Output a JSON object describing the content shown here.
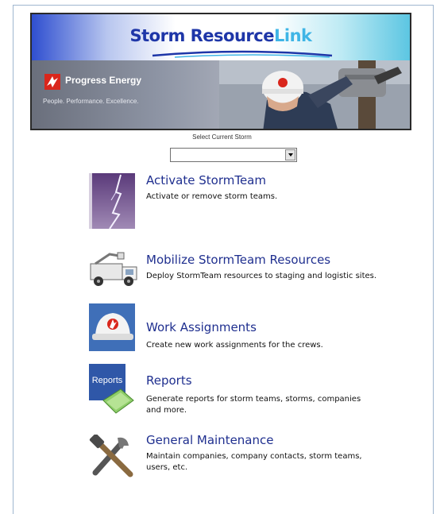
{
  "banner": {
    "app_name_part1": "Storm Resource",
    "app_name_part2": "Link",
    "company_name": "Progress Energy",
    "company_tagline": "People. Performance. Excellence.",
    "accent_colors": {
      "brand_blue": "#1e36a8",
      "brand_light": "#3fb5e6",
      "logo_red": "#d9261c"
    }
  },
  "storm_select": {
    "label": "Select Current Storm",
    "selected_value": ""
  },
  "menu": [
    {
      "title": "Activate StormTeam",
      "description": "Activate or remove storm teams.",
      "icon": "lightning-icon"
    },
    {
      "title": "Mobilize StormTeam Resources",
      "description": "Deploy StormTeam resources to staging and logistic sites.",
      "icon": "bucket-truck-icon"
    },
    {
      "title": "Work Assignments",
      "description": "Create new work assignments for the crews.",
      "icon": "hard-hat-icon"
    },
    {
      "title": "Reports",
      "description": "Generate reports for storm teams, storms, companies and more.",
      "icon": "reports-icon",
      "icon_label": "Reports"
    },
    {
      "title": "General Maintenance",
      "description": "Maintain companies, company contacts, storm teams, users, etc.",
      "icon": "tools-icon"
    }
  ]
}
